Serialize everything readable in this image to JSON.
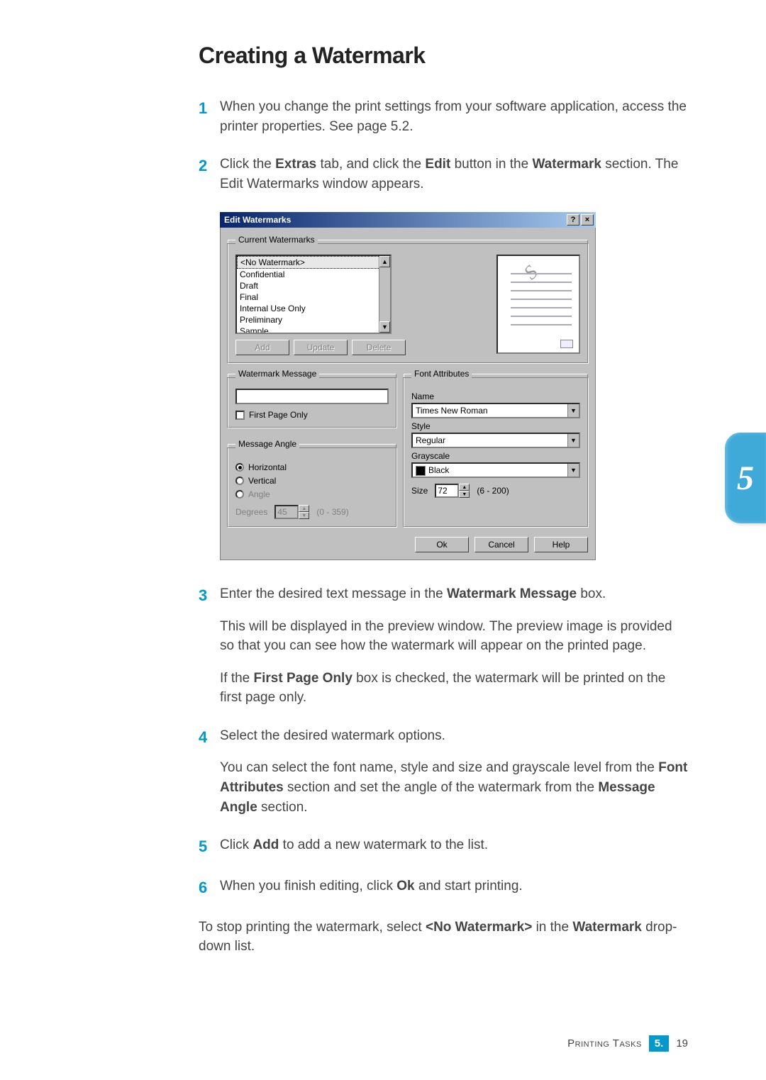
{
  "title": "Creating a Watermark",
  "steps": {
    "s1": {
      "num": "1",
      "text": "When you change the print settings from your software application, access the printer properties. See page 5.2."
    },
    "s2": {
      "num": "2",
      "text_a": "Click the ",
      "b1": "Extras",
      "text_b": " tab, and click the ",
      "b2": "Edit",
      "text_c": " button in the ",
      "b3": "Watermark",
      "text_d": " section. The Edit Watermarks window appears."
    },
    "s3": {
      "num": "3",
      "text_a": "Enter the desired text message in the ",
      "b1": "Watermark Message",
      "text_b": " box.",
      "p2": "This will be displayed in the preview window. The preview image is provided so that you can see how the watermark will appear on the printed page.",
      "p3_a": "If the ",
      "p3_b": "First Page Only",
      "p3_c": " box is checked, the watermark will be printed on the first page only."
    },
    "s4": {
      "num": "4",
      "text": "Select the desired watermark options.",
      "p2_a": "You can select the font name, style and size and grayscale level from the ",
      "p2_b1": "Font Attributes",
      "p2_b": " section and set the angle of the watermark from the ",
      "p2_b2": "Message Angle",
      "p2_c": " section."
    },
    "s5": {
      "num": "5",
      "text_a": "Click ",
      "b1": "Add",
      "text_b": " to add a new watermark to the list."
    },
    "s6": {
      "num": "6",
      "text_a": "When you finish editing, click ",
      "b1": "Ok",
      "text_b": " and start printing."
    },
    "final": {
      "a": "To stop printing the watermark, select ",
      "b": "<No Watermark>",
      "c": " in the ",
      "d": "Watermark",
      "e": " drop-down list."
    }
  },
  "dialog": {
    "title": "Edit Watermarks",
    "help_icon": "?",
    "close_icon": "×",
    "group_current": "Current Watermarks",
    "list_items": [
      "<No Watermark>",
      "Confidential",
      "Draft",
      "Final",
      "Internal Use Only",
      "Preliminary",
      "Sample"
    ],
    "btn_add": "Add",
    "btn_update": "Update",
    "btn_delete": "Delete",
    "preview_letter": "S",
    "group_msg": "Watermark Message",
    "chk_firstpage": "First Page Only",
    "group_angle": "Message Angle",
    "radio_horizontal": "Horizontal",
    "radio_vertical": "Vertical",
    "radio_angle": "Angle",
    "degrees_label": "Degrees",
    "degrees_value": "45",
    "degrees_range": "(0 - 359)",
    "group_font": "Font Attributes",
    "name_label": "Name",
    "name_value": "Times New Roman",
    "style_label": "Style",
    "style_value": "Regular",
    "gray_label": "Grayscale",
    "gray_value": "Black",
    "size_label": "Size",
    "size_value": "72",
    "size_range": "(6 - 200)",
    "btn_ok": "Ok",
    "btn_cancel": "Cancel",
    "btn_help": "Help"
  },
  "sidetab": "5",
  "footer": {
    "tasks": "Printing Tasks",
    "section": "5.",
    "page": "19"
  }
}
